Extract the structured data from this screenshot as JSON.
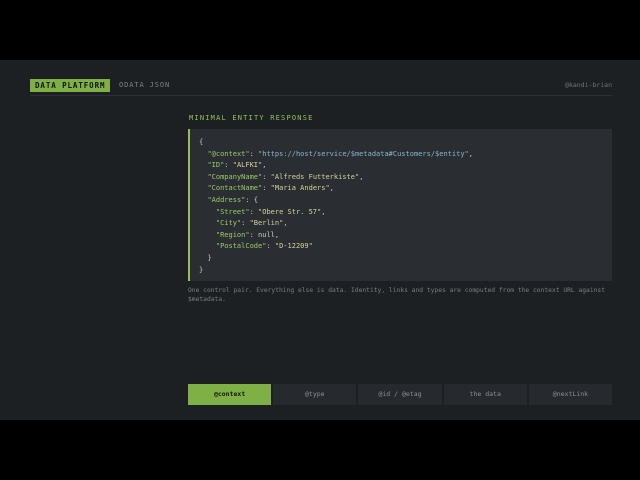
{
  "header": {
    "brand": "DATA PLATFORM",
    "subtitle": "ODATA JSON",
    "user": "@kandi-brian"
  },
  "section": {
    "title": "MINIMAL ENTITY RESPONSE"
  },
  "code": {
    "open_brace": "{",
    "context_key": "\"@context\"",
    "context_value": "\"https://host/service/$metadata#Customers/$entity\"",
    "id_key": "\"ID\"",
    "id_value": "\"ALFKI\"",
    "company_key": "\"CompanyName\"",
    "company_value": "\"Alfreds Futterkiste\"",
    "contact_key": "\"ContactName\"",
    "contact_value": "\"Maria Anders\"",
    "address_key": "\"Address\"",
    "street_key": "\"Street\"",
    "street_value": "\"Obere Str. 57\"",
    "city_key": "\"City\"",
    "city_value": "\"Berlin\"",
    "region_key": "\"Region\"",
    "region_value": "null",
    "postal_key": "\"PostalCode\"",
    "postal_value": "\"D-12209\"",
    "inner_close": "}",
    "close_brace": "}"
  },
  "note": "One control pair. Everything else is data. Identity, links and types are computed from the context URL against $metadata.",
  "tabs": [
    {
      "label": "@context",
      "active": true
    },
    {
      "label": "@type",
      "active": false
    },
    {
      "label": "@id / @etag",
      "active": false
    },
    {
      "label": "the data",
      "active": false
    },
    {
      "label": "@nextLink",
      "active": false
    }
  ],
  "colors": {
    "accent": "#7fb045",
    "background": "#1d2023",
    "code_bg": "#2a2e32"
  }
}
